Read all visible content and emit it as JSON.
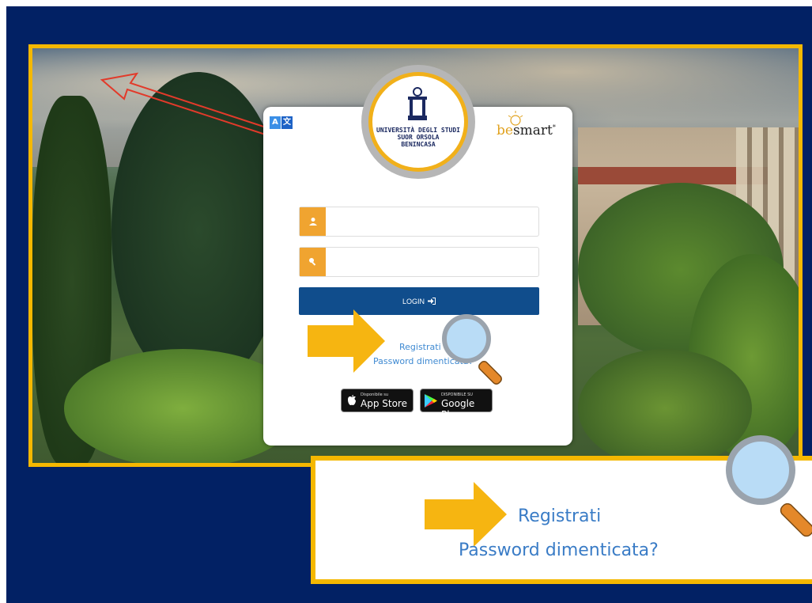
{
  "language_icon": {
    "left": "A",
    "right": "文"
  },
  "seal": {
    "lines": [
      "UNIVERSITÀ DEGLI STUDI",
      "SUOR ORSOLA",
      "BENINCASA"
    ]
  },
  "brand": {
    "part1": "be",
    "part2": "smart",
    "mark": "*"
  },
  "form": {
    "username_value": "",
    "password_value": "",
    "login_label": "LOGIN",
    "login_icon": "sign-in-icon"
  },
  "links": {
    "register": "Registrati",
    "forgot": "Password dimenticata?"
  },
  "stores": {
    "apple_small": "Disponibile su",
    "apple_big": "App Store",
    "google_small": "DISPONIBILE SU",
    "google_big": "Google Play"
  },
  "zoom": {
    "register": "Registrati",
    "forgot": "Password dimenticata?"
  },
  "colors": {
    "background": "#022164",
    "frame": "#f5b800",
    "input_addon": "#f0a430",
    "login_button": "#104d8c",
    "link": "#3f8ad2"
  }
}
